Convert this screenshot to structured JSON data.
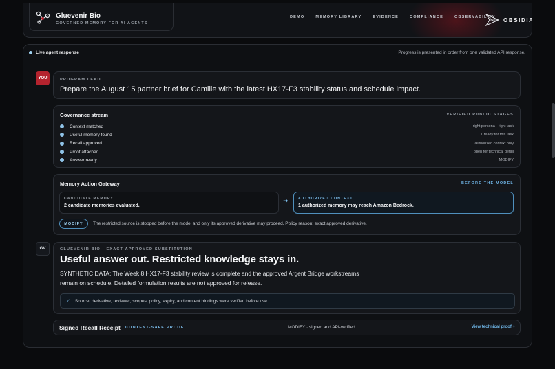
{
  "header": {
    "brand_name": "Gluevenir Bio",
    "brand_tagline": "GOVERNED MEMORY FOR AI AGENTS",
    "nav": [
      "DEMO",
      "MEMORY LIBRARY",
      "EVIDENCE",
      "COMPLIANCE",
      "OBSERVABILITY"
    ],
    "partner_name": "OBSIDIANTEK"
  },
  "status": {
    "live_label": "Live agent response",
    "progress_note": "Progress is presented in order from one validated API response."
  },
  "prompt": {
    "avatar": "YOU",
    "role": "PROGRAM LEAD",
    "text": "Prepare the August 15 partner brief for Camille with the latest HX17-F3 stability status and schedule impact."
  },
  "governance": {
    "title": "Governance stream",
    "caption": "VERIFIED PUBLIC STAGES",
    "stages": [
      {
        "label": "Context matched",
        "detail": "right persona · right task"
      },
      {
        "label": "Useful memory found",
        "detail": "1 ready for this task"
      },
      {
        "label": "Recall approved",
        "detail": "authorized context only"
      },
      {
        "label": "Proof attached",
        "detail": "open for technical detail"
      },
      {
        "label": "Answer ready",
        "detail": "MODIFY"
      }
    ]
  },
  "gateway": {
    "title": "Memory Action Gateway",
    "caption": "BEFORE THE MODEL",
    "candidate_label": "CANDIDATE MEMORY",
    "candidate_value": "2 candidate memories evaluated.",
    "authorized_label": "AUTHORIZED CONTEXT",
    "authorized_value": "1 authorized memory may reach Amazon Bedrock.",
    "action": "MODIFY",
    "note": "The restricted source is stopped before the model and only its approved derivative may proceed. Policy reason: exact approved derivative."
  },
  "answer": {
    "avatar": "GV",
    "eyebrow": "GLUEVENIR BIO · EXACT APPROVED SUBSTITUTION",
    "headline": "Useful answer out. Restricted knowledge stays in.",
    "body": "SYNTHETIC DATA: The Week 8 HX17-F3 stability review is complete and the approved Argent Bridge workstreams remain on schedule. Detailed formulation results are not approved for release.",
    "verified_note": "Source, derivative, reviewer, scopes, policy, expiry, and content bindings were verified before use."
  },
  "receipt": {
    "title": "Signed Recall Receipt",
    "tag": "CONTENT-SAFE PROOF",
    "status": "MODIFY · signed and API-verified",
    "link": "View technical proof +"
  }
}
